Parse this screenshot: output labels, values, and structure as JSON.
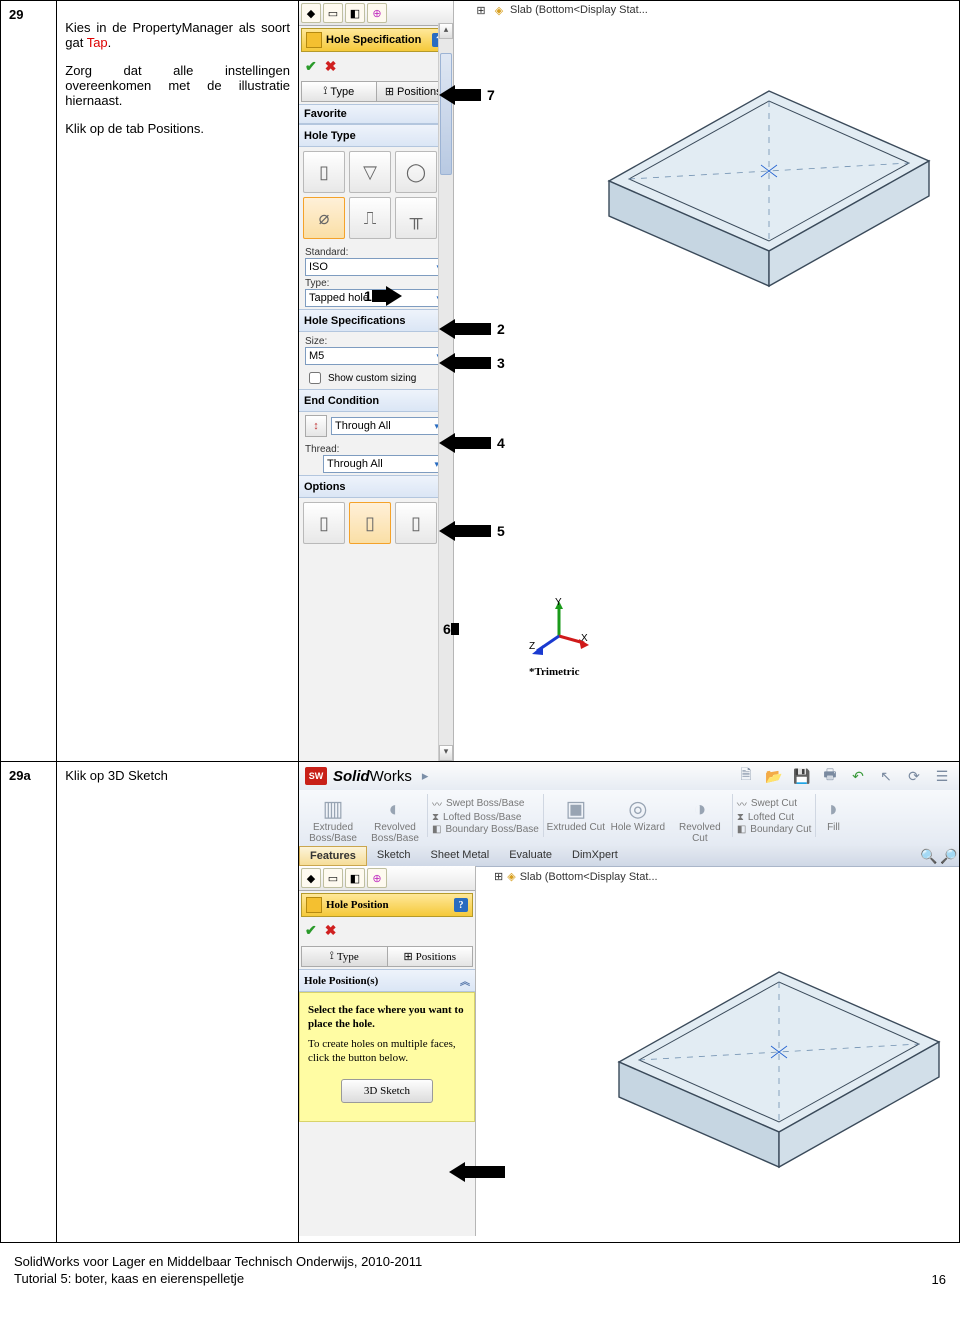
{
  "steps": {
    "row1": {
      "num": "29",
      "p1a": "Kies in de PropertyManager als soort gat ",
      "p1b": "Tap",
      "p1c": ".",
      "p2": "Zorg dat alle instellingen overeenkomen met de illustratie hiernaast.",
      "p3": "Klik op de tab Positions."
    },
    "row2": {
      "num": "29a",
      "p1": "Klik op 3D Sketch"
    }
  },
  "pm": {
    "title": "Hole Specification",
    "help": "?",
    "tab_type": "Type",
    "tab_positions": "Positions",
    "sec_favorite": "Favorite",
    "sec_holetype": "Hole Type",
    "lbl_standard": "Standard:",
    "dd_standard": "ISO",
    "lbl_type": "Type:",
    "dd_type": "Tapped hole",
    "sec_holespec": "Hole Specifications",
    "lbl_size": "Size:",
    "dd_size": "M5",
    "cb_custom": "Show custom sizing",
    "sec_endcond": "End Condition",
    "dd_endcond": "Through All",
    "lbl_thread": "Thread:",
    "dd_thread": "Through All",
    "sec_options": "Options"
  },
  "arrows": {
    "n1": "1",
    "n2": "2",
    "n3": "3",
    "n4": "4",
    "n5": "5",
    "n6": "6",
    "n7": "7"
  },
  "tree": {
    "expand": "⊞",
    "text": "Slab  (Bottom<Display Stat..."
  },
  "triad": {
    "x": "X",
    "y": "Y",
    "z": "Z",
    "label": "*Trimetric"
  },
  "sw": {
    "logo": "SW",
    "brand_bold": "Solid",
    "brand_rest": "Works",
    "cmds": {
      "ext_bb": "Extruded Boss/Base",
      "rev_bb": "Revolved Boss/Base",
      "swept_bb": "Swept Boss/Base",
      "lofted_bb": "Lofted Boss/Base",
      "boundary_bb": "Boundary Boss/Base",
      "ext_cut": "Extruded Cut",
      "hole_wiz": "Hole Wizard",
      "rev_cut": "Revolved Cut",
      "swept_cut": "Swept Cut",
      "lofted_cut": "Lofted Cut",
      "boundary_cut": "Boundary Cut",
      "fill": "Fill"
    },
    "tabs": {
      "features": "Features",
      "sketch": "Sketch",
      "sheetmetal": "Sheet Metal",
      "evaluate": "Evaluate",
      "dimxpert": "DimXpert"
    }
  },
  "pm2": {
    "title": "Hole Position",
    "tab_type": "Type",
    "tab_positions": "Positions",
    "sec": "Hole Position(s)",
    "msg1": "Select the face where you want to place the hole.",
    "msg2": "To create holes on multiple faces, click the button below.",
    "btn": "3D Sketch"
  },
  "footer": {
    "line1": "SolidWorks voor Lager en Middelbaar Technisch Onderwijs, 2010-2011",
    "line2": "Tutorial 5: boter, kaas en eierenspelletje",
    "page": "16"
  }
}
